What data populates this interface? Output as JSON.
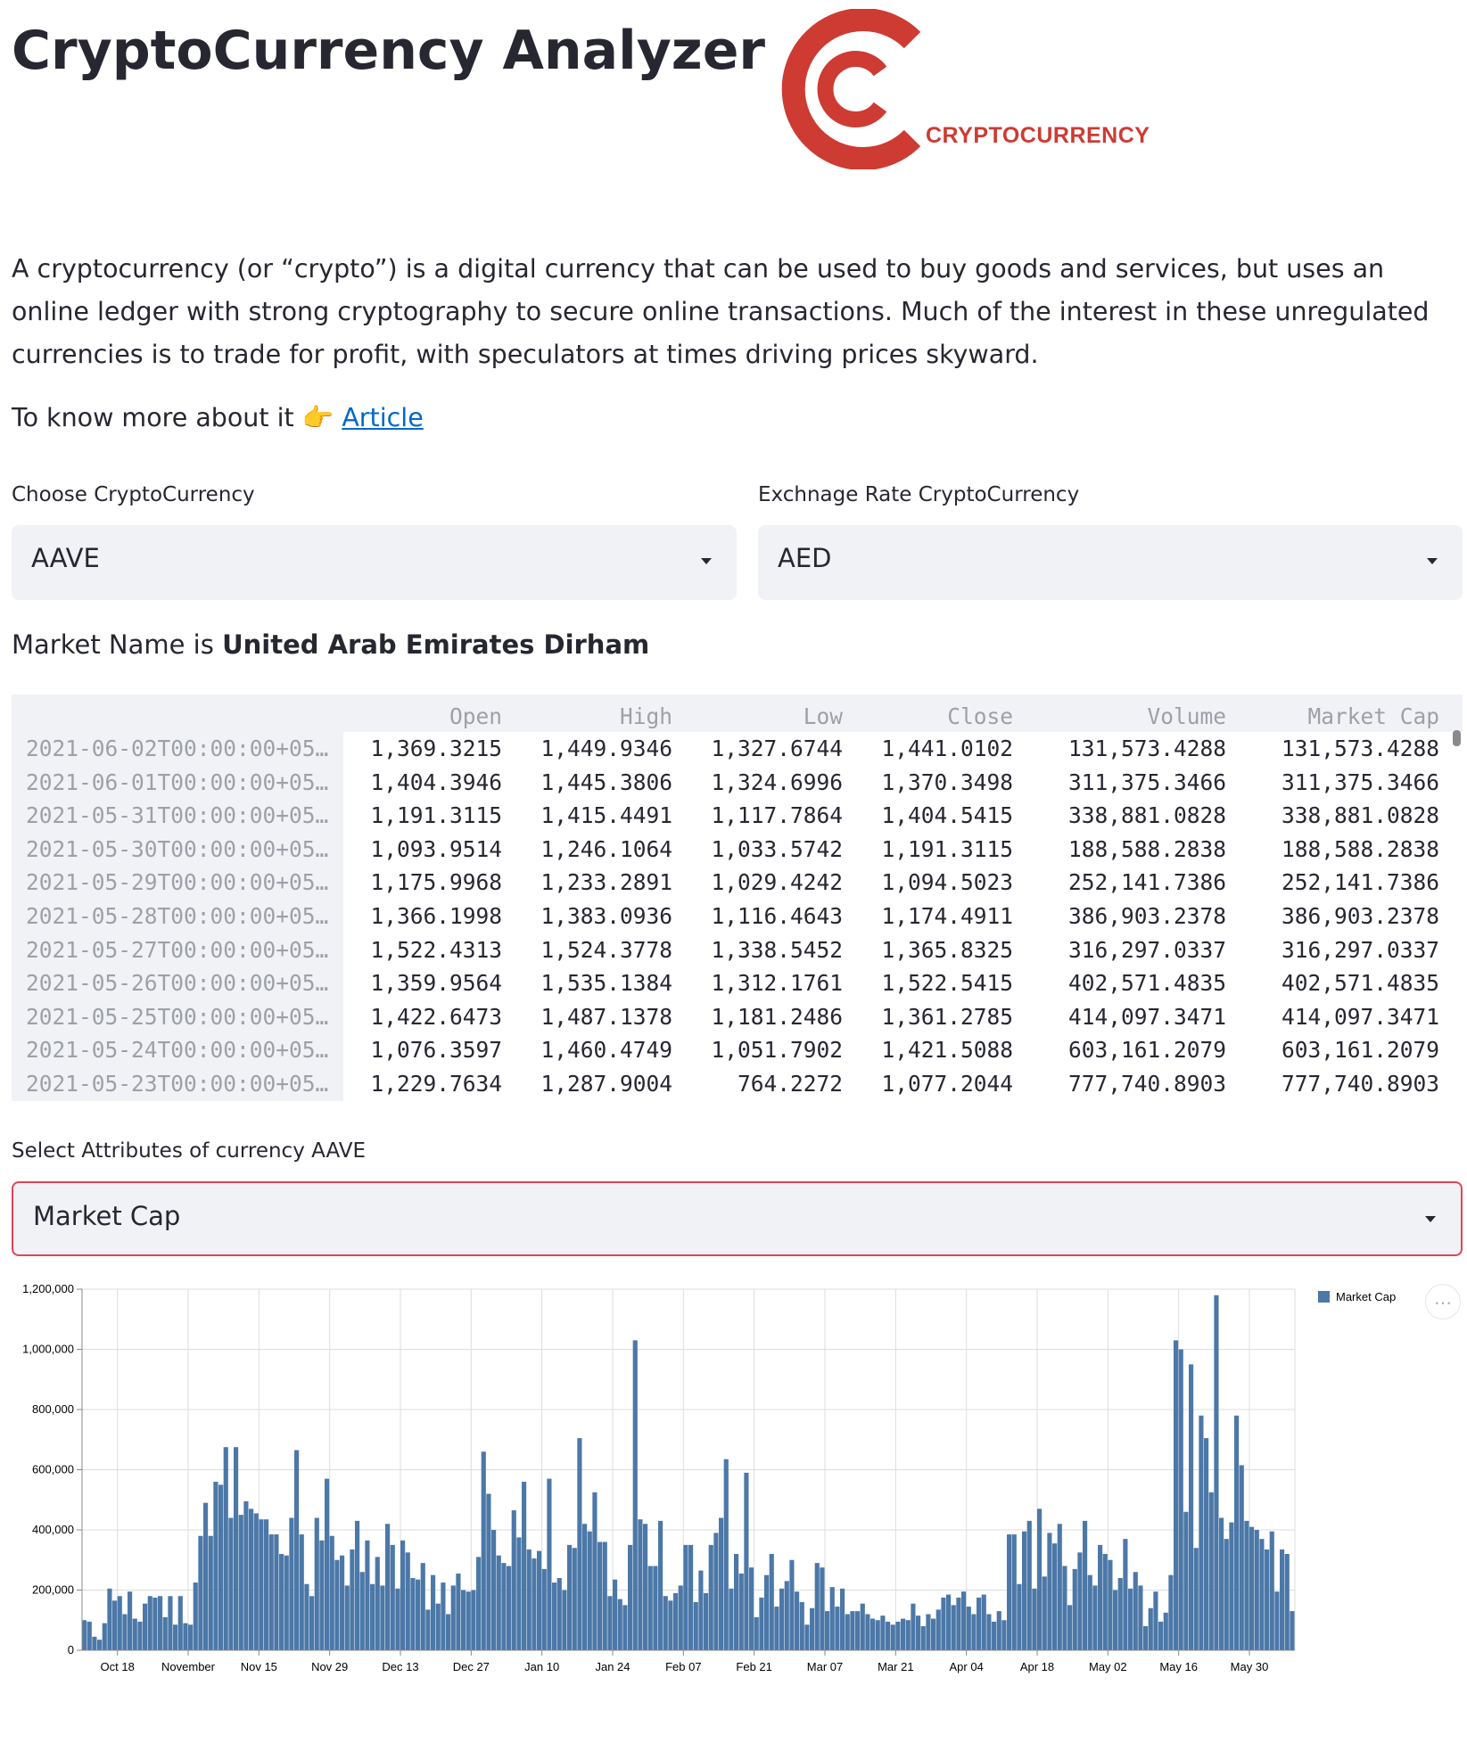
{
  "header": {
    "title": "CryptoCurrency Analyzer",
    "logo_text": "CRYPTOCURRENCY"
  },
  "intro": "A cryptocurrency (or “crypto”) is a digital currency that can be used to buy goods and services, but uses an online ledger with strong cryptography to secure online transactions. Much of the interest in these unregulated currencies is to trade for profit, with speculators at times driving prices skyward.",
  "more": {
    "prefix": "To know more about it 👉 ",
    "link_label": "Article"
  },
  "crypto_select": {
    "label": "Choose CryptoCurrency",
    "value": "AAVE"
  },
  "rate_select": {
    "label": "Exchnage Rate CryptoCurrency",
    "value": "AED"
  },
  "market": {
    "prefix": "Market Name is ",
    "name": "United Arab Emirates Dirham"
  },
  "table": {
    "columns": [
      "Open",
      "High",
      "Low",
      "Close",
      "Volume",
      "Market Cap"
    ],
    "rows": [
      {
        "index": "2021-06-02T00:00:00+05…",
        "cells": [
          "1,369.3215",
          "1,449.9346",
          "1,327.6744",
          "1,441.0102",
          "131,573.4288",
          "131,573.4288"
        ]
      },
      {
        "index": "2021-06-01T00:00:00+05…",
        "cells": [
          "1,404.3946",
          "1,445.3806",
          "1,324.6996",
          "1,370.3498",
          "311,375.3466",
          "311,375.3466"
        ]
      },
      {
        "index": "2021-05-31T00:00:00+05…",
        "cells": [
          "1,191.3115",
          "1,415.4491",
          "1,117.7864",
          "1,404.5415",
          "338,881.0828",
          "338,881.0828"
        ]
      },
      {
        "index": "2021-05-30T00:00:00+05…",
        "cells": [
          "1,093.9514",
          "1,246.1064",
          "1,033.5742",
          "1,191.3115",
          "188,588.2838",
          "188,588.2838"
        ]
      },
      {
        "index": "2021-05-29T00:00:00+05…",
        "cells": [
          "1,175.9968",
          "1,233.2891",
          "1,029.4242",
          "1,094.5023",
          "252,141.7386",
          "252,141.7386"
        ]
      },
      {
        "index": "2021-05-28T00:00:00+05…",
        "cells": [
          "1,366.1998",
          "1,383.0936",
          "1,116.4643",
          "1,174.4911",
          "386,903.2378",
          "386,903.2378"
        ]
      },
      {
        "index": "2021-05-27T00:00:00+05…",
        "cells": [
          "1,522.4313",
          "1,524.3778",
          "1,338.5452",
          "1,365.8325",
          "316,297.0337",
          "316,297.0337"
        ]
      },
      {
        "index": "2021-05-26T00:00:00+05…",
        "cells": [
          "1,359.9564",
          "1,535.1384",
          "1,312.1761",
          "1,522.5415",
          "402,571.4835",
          "402,571.4835"
        ]
      },
      {
        "index": "2021-05-25T00:00:00+05…",
        "cells": [
          "1,422.6473",
          "1,487.1378",
          "1,181.2486",
          "1,361.2785",
          "414,097.3471",
          "414,097.3471"
        ]
      },
      {
        "index": "2021-05-24T00:00:00+05…",
        "cells": [
          "1,076.3597",
          "1,460.4749",
          "1,051.7902",
          "1,421.5088",
          "603,161.2079",
          "603,161.2079"
        ]
      },
      {
        "index": "2021-05-23T00:00:00+05…",
        "cells": [
          "1,229.7634",
          "1,287.9004",
          "764.2272",
          "1,077.2044",
          "777,740.8903",
          "777,740.8903"
        ]
      }
    ]
  },
  "attr_select": {
    "label": "Select Attributes of currency AAVE",
    "value": "Market Cap"
  },
  "colors": {
    "bar": "#4c78a8",
    "accent": "#e0455a",
    "link": "#0068c9",
    "logo": "#cd3b33"
  },
  "chart_data": {
    "type": "bar",
    "legend": "top-right",
    "grid": true,
    "ylim": [
      0,
      1200000
    ],
    "y_ticks": [
      "0",
      "200,000",
      "400,000",
      "600,000",
      "800,000",
      "1,000,000",
      "1,200,000"
    ],
    "x_ticks": [
      "Oct 18",
      "November",
      "Nov 15",
      "Nov 29",
      "Dec 13",
      "Dec 27",
      "Jan 10",
      "Jan 24",
      "Feb 07",
      "Feb 21",
      "Mar 07",
      "Mar 21",
      "Apr 04",
      "Apr 18",
      "May 02",
      "May 16",
      "May 30"
    ],
    "series": [
      {
        "name": "Market Cap",
        "values": [
          100000,
          95000,
          45000,
          35000,
          90000,
          205000,
          165000,
          180000,
          120000,
          195000,
          105000,
          95000,
          155000,
          180000,
          175000,
          180000,
          110000,
          180000,
          85000,
          180000,
          90000,
          85000,
          225000,
          380000,
          490000,
          380000,
          560000,
          550000,
          675000,
          440000,
          675000,
          450000,
          495000,
          470000,
          455000,
          435000,
          435000,
          385000,
          385000,
          320000,
          315000,
          440000,
          665000,
          385000,
          220000,
          180000,
          440000,
          365000,
          570000,
          380000,
          300000,
          315000,
          215000,
          335000,
          430000,
          260000,
          365000,
          220000,
          310000,
          215000,
          420000,
          350000,
          205000,
          365000,
          325000,
          240000,
          235000,
          290000,
          135000,
          250000,
          155000,
          225000,
          120000,
          215000,
          255000,
          200000,
          195000,
          200000,
          310000,
          660000,
          520000,
          400000,
          315000,
          290000,
          280000,
          465000,
          375000,
          560000,
          335000,
          305000,
          330000,
          270000,
          570000,
          225000,
          240000,
          200000,
          350000,
          340000,
          705000,
          420000,
          395000,
          525000,
          360000,
          360000,
          180000,
          235000,
          170000,
          150000,
          350000,
          1030000,
          435000,
          420000,
          280000,
          280000,
          430000,
          180000,
          165000,
          190000,
          215000,
          350000,
          350000,
          160000,
          265000,
          190000,
          350000,
          390000,
          440000,
          635000,
          205000,
          320000,
          255000,
          590000,
          275000,
          110000,
          175000,
          250000,
          320000,
          145000,
          205000,
          230000,
          300000,
          195000,
          160000,
          85000,
          140000,
          290000,
          275000,
          130000,
          210000,
          145000,
          205000,
          120000,
          130000,
          130000,
          155000,
          120000,
          105000,
          100000,
          115000,
          95000,
          85000,
          95000,
          105000,
          100000,
          155000,
          115000,
          80000,
          120000,
          105000,
          135000,
          175000,
          185000,
          150000,
          175000,
          195000,
          145000,
          120000,
          175000,
          185000,
          120000,
          95000,
          130000,
          100000,
          385000,
          385000,
          220000,
          395000,
          430000,
          205000,
          470000,
          245000,
          390000,
          355000,
          420000,
          280000,
          150000,
          270000,
          325000,
          430000,
          250000,
          215000,
          350000,
          320000,
          300000,
          200000,
          240000,
          370000,
          205000,
          260000,
          215000,
          80000,
          140000,
          195000,
          95000,
          125000,
          250000,
          1030000,
          1000000,
          460000,
          950000,
          340000,
          780000,
          705000,
          525000,
          1180000,
          440000,
          370000,
          425000,
          780000,
          615000,
          430000,
          410000,
          400000,
          370000,
          335000,
          395000,
          195000,
          335000,
          320000,
          130000
        ]
      }
    ]
  }
}
